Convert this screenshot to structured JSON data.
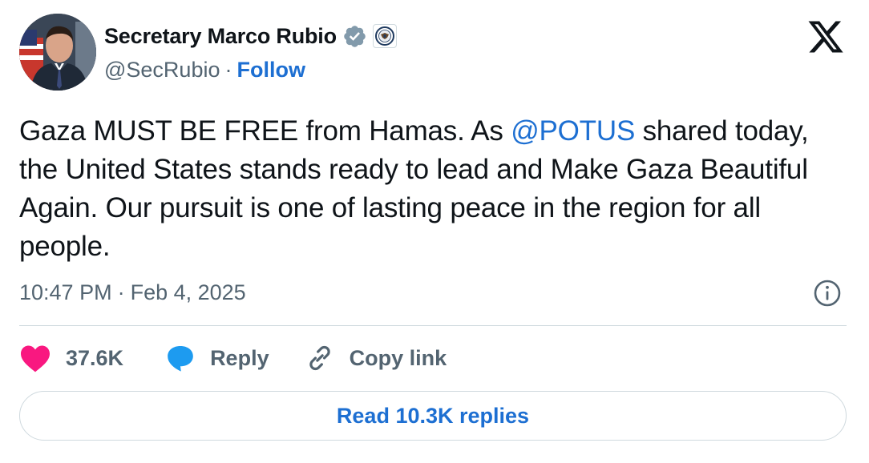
{
  "author": {
    "display_name": "Secretary Marco Rubio",
    "handle": "@SecRubio",
    "separator": "·",
    "follow_label": "Follow",
    "verified_badge": "verified-badge-icon",
    "affiliation_badge": "state-department-seal-icon"
  },
  "tweet": {
    "text_before": "Gaza MUST BE FREE from Hamas. As ",
    "mention": "@POTUS",
    "text_after": " shared today, the United States stands ready to lead and Make Gaza Beautiful Again. Our pursuit is one of lasting peace in the region for all people."
  },
  "meta": {
    "time": "10:47 PM",
    "separator": "·",
    "date": "Feb 4, 2025"
  },
  "actions": {
    "like_count": "37.6K",
    "reply_label": "Reply",
    "copy_link_label": "Copy link"
  },
  "read_replies_label": "Read 10.3K replies",
  "colors": {
    "link_blue": "#1d6fd2",
    "like_pink": "#f91880",
    "reply_blue": "#1d9bf0",
    "muted_gray": "#536471",
    "text": "#0f1419",
    "border": "#cfd9de"
  }
}
